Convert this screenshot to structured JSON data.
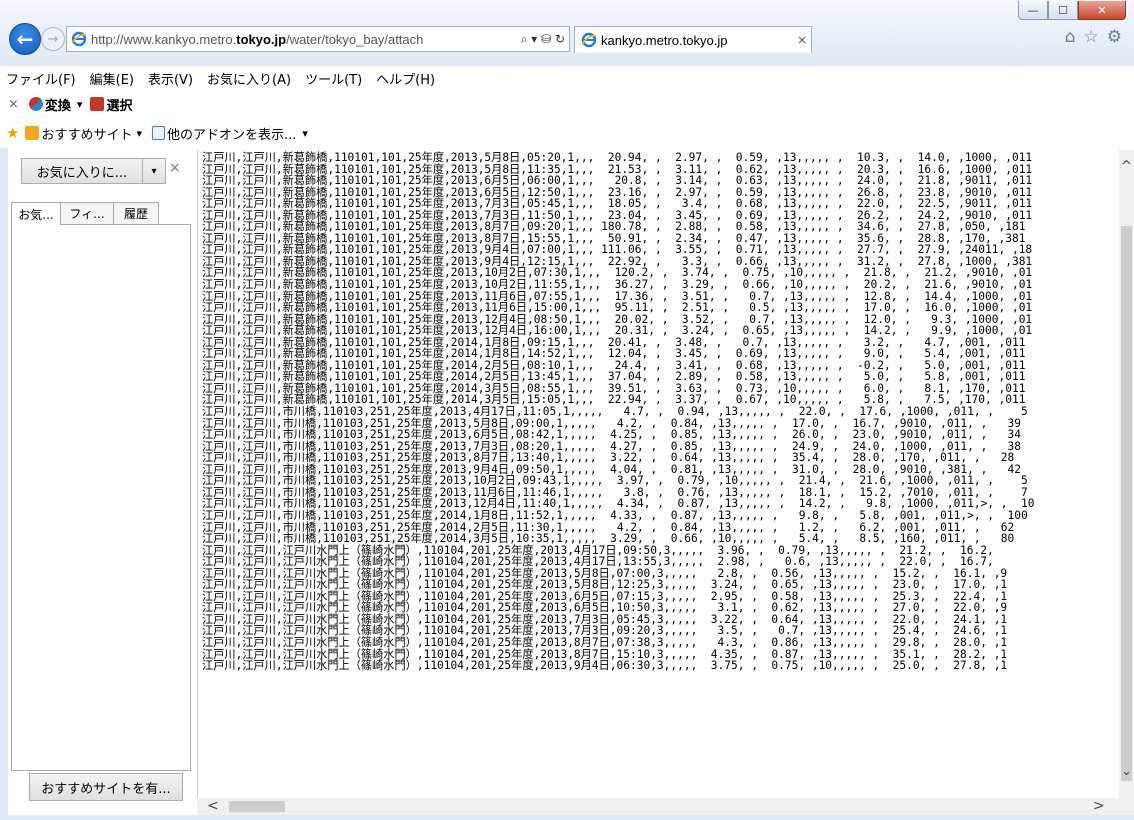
{
  "window": {
    "min": "—",
    "max": "☐",
    "close": "✕"
  },
  "nav": {
    "back": "←",
    "forward": "→"
  },
  "address": {
    "url_prefix": "http://www.kankyo.metro.",
    "url_bold": "tokyo.jp",
    "url_suffix": "/water/tokyo_bay/attach",
    "tools": "⌕ ▾ ⛁ ↻"
  },
  "tab": {
    "title": "kankyo.metro.tokyo.jp",
    "close": "×"
  },
  "toolbar_icons": {
    "home": "⌂",
    "favorites": "☆",
    "settings": "⚙"
  },
  "menu": [
    "ファイル(F)",
    "編集(E)",
    "表示(V)",
    "お気に入り(A)",
    "ツール(T)",
    "ヘルプ(H)"
  ],
  "cmd": {
    "close": "×",
    "convert": "変換",
    "convert_drop": "▾",
    "select": "選択"
  },
  "fav": {
    "suggested": "おすすめサイト",
    "suggested_drop": "▾",
    "addons": "他のアドオンを表示...",
    "addons_drop": "▾"
  },
  "sidebar": {
    "add_button": "お気に入りに...",
    "add_drop": "▾",
    "close": "×",
    "tabs": [
      "お気...",
      "フィ...",
      "履歴"
    ],
    "bottom_button": "おすすめサイトを有..."
  },
  "scroll": {
    "up": "^",
    "down": "⌄",
    "left": "<",
    "right": ">"
  },
  "content_lines": [
    "江戸川,江戸川,新葛飾橋,110101,101,25年度,2013,5月8日,05:20,1,,,  20.94, ,  2.97, ,  0.59, ,13,,,,, ,  10.3, ,  14.0, ,1000, ,011",
    "江戸川,江戸川,新葛飾橋,110101,101,25年度,2013,5月8日,11:35,1,,,  21.53, ,  3.11, ,  0.62, ,13,,,,, ,  20.3, ,  16.6, ,1000, ,011",
    "江戸川,江戸川,新葛飾橋,110101,101,25年度,2013,6月5日,06:00,1,,,   20.8, ,  3.14, ,  0.63, ,13,,,,, ,  24.0, ,  21.8, ,9011, ,011",
    "江戸川,江戸川,新葛飾橋,110101,101,25年度,2013,6月5日,12:50,1,,,  23.16, ,  2.97, ,  0.59, ,13,,,,, ,  26.8, ,  23.8, ,9010, ,011",
    "江戸川,江戸川,新葛飾橋,110101,101,25年度,2013,7月3日,05:45,1,,,  18.05, ,   3.4, ,  0.68, ,13,,,,, ,  22.0, ,  22.5, ,9011, ,011",
    "江戸川,江戸川,新葛飾橋,110101,101,25年度,2013,7月3日,11:50,1,,,  23.04, ,  3.45, ,  0.69, ,13,,,,, ,  26.2, ,  24.2, ,9010, ,011",
    "江戸川,江戸川,新葛飾橋,110101,101,25年度,2013,8月7日,09:20,1,,, 180.78, ,  2.88, ,  0.58, ,13,,,,, ,  34.6, ,  27.8, ,050, ,181",
    "江戸川,江戸川,新葛飾橋,110101,101,25年度,2013,8月7日,15:55,1,,,  50.91, ,  2.34, ,  0.47, ,13,,,,, ,  35.6, ,  28.8, ,170, ,381",
    "江戸川,江戸川,新葛飾橋,110101,101,25年度,2013,9月4日,07:00,1,,, 111.06, ,  3.55, ,  0.71, ,13,,,,, ,  27.7, ,  27.9, ,24011, ,18",
    "江戸川,江戸川,新葛飾橋,110101,101,25年度,2013,9月4日,12:15,1,,,  22.92, ,   3.3, ,  0.66, ,13,,,,, ,  31.2, ,  27.8, ,1000, ,381",
    "江戸川,江戸川,新葛飾橋,110101,101,25年度,2013,10月2日,07:30,1,,,  120.2, ,  3.74, ,  0.75, ,10,,,,, ,  21.8, ,  21.2, ,9010, ,01",
    "江戸川,江戸川,新葛飾橋,110101,101,25年度,2013,10月2日,11:55,1,,,  36.27, ,  3.29, ,  0.66, ,10,,,,, ,  20.2, ,  21.6, ,9010, ,01",
    "江戸川,江戸川,新葛飾橋,110101,101,25年度,2013,11月6日,07:55,1,,,  17.36, ,  3.51, ,   0.7, ,13,,,,, ,  12.8, ,  14.4, ,1000, ,01",
    "江戸川,江戸川,新葛飾橋,110101,101,25年度,2013,11月6日,15:00,1,,,  95.11, ,  2.51, ,   0.5, ,13,,,,, ,  17.0, ,  16.0, ,1000, ,01",
    "江戸川,江戸川,新葛飾橋,110101,101,25年度,2013,12月4日,08:50,1,,,  20.02, ,  3.52, ,   0.7, ,13,,,,, ,  12.0, ,   9.3, ,1000, ,01",
    "江戸川,江戸川,新葛飾橋,110101,101,25年度,2013,12月4日,16:00,1,,,  20.31, ,  3.24, ,  0.65, ,13,,,,, ,  14.2, ,   9.9, ,1000, ,01",
    "江戸川,江戸川,新葛飾橋,110101,101,25年度,2014,1月8日,09:15,1,,,  20.41, ,  3.48, ,   0.7, ,13,,,,, ,   3.2, ,   4.7, ,001, ,011",
    "江戸川,江戸川,新葛飾橋,110101,101,25年度,2014,1月8日,14:52,1,,,  12.04, ,  3.45, ,  0.69, ,13,,,,, ,   9.0, ,   5.4, ,001, ,011",
    "江戸川,江戸川,新葛飾橋,110101,101,25年度,2014,2月5日,08:10,1,,,   24.4, ,  3.41, ,  0.68, ,13,,,,, ,  -0.2, ,   5.0, ,001, ,011",
    "江戸川,江戸川,新葛飾橋,110101,101,25年度,2014,2月5日,13:45,1,,,  37.04, ,  2.89, ,  0.58, ,13,,,,, ,   5.0, ,   5.8, ,001, ,011",
    "江戸川,江戸川,新葛飾橋,110101,101,25年度,2014,3月5日,08:55,1,,,  39.51, ,  3.63, ,  0.73, ,10,,,,, ,   6.0, ,   8.1, ,170, ,011",
    "江戸川,江戸川,新葛飾橋,110101,101,25年度,2014,3月5日,15:05,1,,,  22.94, ,  3.37, ,  0.67, ,10,,,,, ,   5.8, ,   7.5, ,170, ,011",
    "江戸川,江戸川,市川橋,110103,251,25年度,2013,4月17日,11:05,1,,,,,   4.7, ,  0.94, ,13,,,,, ,  22.0, ,  17.6, ,1000, ,011, ,    5",
    "江戸川,江戸川,市川橋,110103,251,25年度,2013,5月8日,09:00,1,,,,,   4.2, ,  0.84, ,13,,,,, ,  17.0, ,  16.7, ,9010, ,011, ,   39",
    "江戸川,江戸川,市川橋,110103,251,25年度,2013,6月5日,08:42,1,,,,,  4.25, ,  0.85, ,13,,,,, ,  26.0, ,  23.0, ,9010, ,011, ,   34",
    "江戸川,江戸川,市川橋,110103,251,25年度,2013,7月3日,08:20,1,,,,,  4.27, ,  0.85, ,13,,,,, ,  24.9, ,  24.0, ,1000, ,011, ,   38",
    "江戸川,江戸川,市川橋,110103,251,25年度,2013,8月7日,13:40,1,,,,,  3.22, ,  0.64, ,13,,,,, ,  35.4, ,  28.0, ,170, ,011, ,   28",
    "江戸川,江戸川,市川橋,110103,251,25年度,2013,9月4日,09:50,1,,,,,  4.04, ,  0.81, ,13,,,,, ,  31.0, ,  28.0, ,9010, ,381, ,   42",
    "江戸川,江戸川,市川橋,110103,251,25年度,2013,10月2日,09:43,1,,,,,  3.97, ,  0.79, ,10,,,,, ,  21.4, ,  21.6, ,1000, ,011, ,    5",
    "江戸川,江戸川,市川橋,110103,251,25年度,2013,11月6日,11:46,1,,,,,   3.8, ,  0.76, ,13,,,,, ,  18.1, ,  15.2, ,7010, ,011, ,    7",
    "江戸川,江戸川,市川橋,110103,251,25年度,2013,12月4日,11:40,1,,,,,  4.34, ,  0.87, ,13,,,,, ,  14.2, ,   9.8, ,1000, ,011,>, ,  10",
    "江戸川,江戸川,市川橋,110103,251,25年度,2014,1月8日,11:52,1,,,,,  4.33, ,  0.87, ,13,,,,, ,   9.8, ,   5.8, ,001, ,011,>, ,  100",
    "江戸川,江戸川,市川橋,110103,251,25年度,2014,2月5日,11:30,1,,,,,   4.2, ,  0.84, ,13,,,,, ,   1.2, ,   6.2, ,001, ,011, ,   62",
    "江戸川,江戸川,市川橋,110103,251,25年度,2014,3月5日,10:35,1,,,,,  3.29, ,  0.66, ,10,,,,, ,   5.4, ,   8.5, ,160, ,011, ,   80",
    "江戸川,江戸川,江戸川水門上（篠崎水門）,110104,201,25年度,2013,4月17日,09:50,3,,,,,  3.96, ,  0.79, ,13,,,,, ,  21.2, ,  16.2,",
    "江戸川,江戸川,江戸川水門上（篠崎水門）,110104,201,25年度,2013,4月17日,13:55,3,,,,,  2.98, ,   0.6, ,13,,,,, ,  22.0, ,  16.7,",
    "江戸川,江戸川,江戸川水門上（篠崎水門）,110104,201,25年度,2013,5月8日,07:00,3,,,,,   2.8, ,  0.56, ,13,,,,, ,  15.2, ,  16.1, ,9",
    "江戸川,江戸川,江戸川水門上（篠崎水門）,110104,201,25年度,2013,5月8日,12:25,3,,,,,  3.24, ,  0.65, ,13,,,,, ,  23.0, ,  17.0, ,1",
    "江戸川,江戸川,江戸川水門上（篠崎水門）,110104,201,25年度,2013,6月5日,07:15,3,,,,,  2.95, ,  0.58, ,13,,,,, ,  25.3, ,  22.4, ,1",
    "江戸川,江戸川,江戸川水門上（篠崎水門）,110104,201,25年度,2013,6月5日,10:50,3,,,,,   3.1, ,  0.62, ,13,,,,, ,  27.0, ,  22.0, ,9",
    "江戸川,江戸川,江戸川水門上（篠崎水門）,110104,201,25年度,2013,7月3日,05:45,3,,,,,  3.22, ,  0.64, ,13,,,,, ,  22.0, ,  24.1, ,1",
    "江戸川,江戸川,江戸川水門上（篠崎水門）,110104,201,25年度,2013,7月3日,09:20,3,,,,,   3.5, ,   0.7, ,13,,,,, ,  25.4, ,  24.6, ,1",
    "江戸川,江戸川,江戸川水門上（篠崎水門）,110104,201,25年度,2013,8月7日,07:38,3,,,,,   4.3, ,  0.86, ,13,,,,, ,  29.8, ,  28.0, ,1",
    "江戸川,江戸川,江戸川水門上（篠崎水門）,110104,201,25年度,2013,8月7日,15:10,3,,,,,  4.35, ,  0.87, ,13,,,,, ,  35.1, ,  28.2, ,1",
    "江戸川,江戸川,江戸川水門上（篠崎水門）,110104,201,25年度,2013,9月4日,06:30,3,,,,,  3.75, ,  0.75, ,10,,,,, ,  25.0, ,  27.8, ,1"
  ]
}
